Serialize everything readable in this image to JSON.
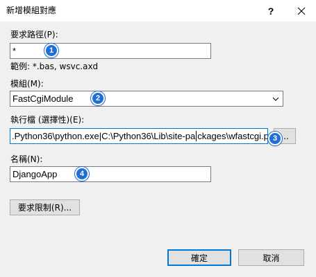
{
  "window": {
    "title": "新增模組對應",
    "help_label": "?",
    "close_icon": "close-icon"
  },
  "request_path": {
    "label": "要求路徑(P):",
    "value": "*",
    "example": "範例: *.bas, wsvc.axd"
  },
  "module": {
    "label": "模組(M):",
    "selected": "FastCgiModule"
  },
  "executable": {
    "label": "執行檔 (選擇性)(E):",
    "value_left": ".Python36\\python.exe|C:\\Python36\\Lib\\site-pa",
    "value_right": "ckages\\wfastcgi.py",
    "browse_label": "..."
  },
  "name": {
    "label": "名稱(N):",
    "value": "DjangoApp"
  },
  "buttons": {
    "request_restrictions": "要求限制(R)...",
    "ok": "確定",
    "cancel": "取消"
  },
  "callouts": [
    "1",
    "2",
    "3",
    "4"
  ],
  "colors": {
    "accent": "#0078d7",
    "badge": "#1f6fd6",
    "background": "#f0f0f0"
  }
}
